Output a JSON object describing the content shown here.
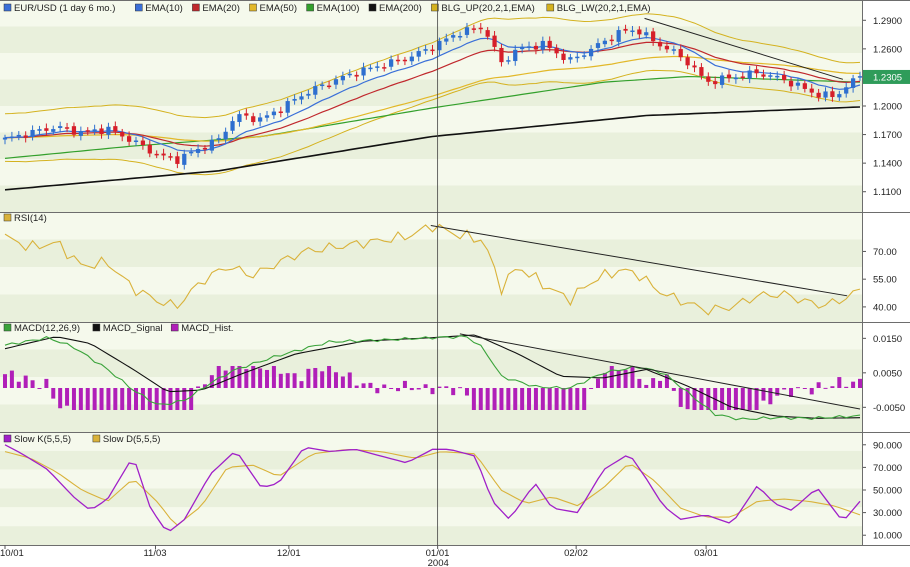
{
  "title": "EUR/USD (1 day 6 mo.)",
  "colors": {
    "background": "#ffffff",
    "band_light": "#f5f9ec",
    "band_dark": "#e9f0dc",
    "axis_text": "#222222",
    "up_candle": "#2e6fcf",
    "down_candle": "#d61f2a",
    "ema10": "#3a6fd8",
    "ema20": "#c0282d",
    "ema50": "#e2b829",
    "ema100": "#33a02c",
    "ema200": "#111111",
    "bollinger": "#d4b21f",
    "rsi": "#d9b23a",
    "macd": "#3aa33a",
    "macd_signal": "#111111",
    "macd_hist": "#b01fb8",
    "slow_k": "#a020c8",
    "slow_d": "#d9b23a",
    "trend": "#222222",
    "price_tag": "#2f9c5a"
  },
  "legends": {
    "price": [
      {
        "label": "EUR/USD (1 day 6 mo.)",
        "color": "#3a6fd8"
      },
      {
        "label": "EMA(10)",
        "color": "#3a6fd8"
      },
      {
        "label": "EMA(20)",
        "color": "#c0282d"
      },
      {
        "label": "EMA(50)",
        "color": "#e2b829"
      },
      {
        "label": "EMA(100)",
        "color": "#33a02c"
      },
      {
        "label": "EMA(200)",
        "color": "#111111"
      },
      {
        "label": "BLG_UP(20,2,1,EMA)",
        "color": "#d4b21f"
      },
      {
        "label": "BLG_LW(20,2,1,EMA)",
        "color": "#d4b21f"
      }
    ],
    "rsi": [
      {
        "label": "RSI(14)",
        "color": "#d9b23a"
      }
    ],
    "macd": [
      {
        "label": "MACD(12,26,9)",
        "color": "#3aa33a"
      },
      {
        "label": "MACD_Signal",
        "color": "#111111"
      },
      {
        "label": "MACD_Hist.",
        "color": "#b01fb8"
      }
    ],
    "stoch": [
      {
        "label": "Slow K(5,5,5)",
        "color": "#a020c8"
      },
      {
        "label": "Slow D(5,5,5)",
        "color": "#d9b23a"
      }
    ]
  },
  "current_price": "1.2305",
  "x_axis": {
    "labels": [
      {
        "text": "10/01",
        "t": 0
      },
      {
        "text": "11/03",
        "t": 0.176
      },
      {
        "text": "12/01",
        "t": 0.332
      },
      {
        "text": "01/01",
        "t": 0.506
      },
      {
        "text": "02/02",
        "t": 0.668
      },
      {
        "text": "03/01",
        "t": 0.82
      }
    ],
    "year_label": {
      "text": "2004",
      "t": 0.506
    }
  },
  "crosshair_t": 0.506,
  "chart_data": [
    {
      "type": "candlestick",
      "name": "EUR/USD (1 day 6 mo.)",
      "ylim": [
        1.095,
        1.305
      ],
      "yticks": [
        "1.2900",
        "1.2600",
        "1.2300",
        "1.2000",
        "1.1700",
        "1.1400",
        "1.1100"
      ],
      "close_anchors": [
        [
          0,
          1.165
        ],
        [
          0.03,
          1.172
        ],
        [
          0.06,
          1.178
        ],
        [
          0.09,
          1.172
        ],
        [
          0.12,
          1.176
        ],
        [
          0.15,
          1.163
        ],
        [
          0.18,
          1.148
        ],
        [
          0.2,
          1.143
        ],
        [
          0.22,
          1.152
        ],
        [
          0.25,
          1.165
        ],
        [
          0.27,
          1.19
        ],
        [
          0.3,
          1.186
        ],
        [
          0.32,
          1.196
        ],
        [
          0.35,
          1.213
        ],
        [
          0.38,
          1.225
        ],
        [
          0.41,
          1.235
        ],
        [
          0.44,
          1.243
        ],
        [
          0.47,
          1.25
        ],
        [
          0.5,
          1.262
        ],
        [
          0.53,
          1.277
        ],
        [
          0.56,
          1.283
        ],
        [
          0.58,
          1.245
        ],
        [
          0.6,
          1.26
        ],
        [
          0.63,
          1.265
        ],
        [
          0.66,
          1.247
        ],
        [
          0.69,
          1.262
        ],
        [
          0.72,
          1.278
        ],
        [
          0.74,
          1.28
        ],
        [
          0.76,
          1.267
        ],
        [
          0.78,
          1.258
        ],
        [
          0.8,
          1.245
        ],
        [
          0.82,
          1.225
        ],
        [
          0.85,
          1.23
        ],
        [
          0.88,
          1.235
        ],
        [
          0.91,
          1.228
        ],
        [
          0.93,
          1.22
        ],
        [
          0.95,
          1.212
        ],
        [
          0.97,
          1.21
        ],
        [
          1.0,
          1.232
        ]
      ],
      "ema200_anchors": [
        [
          0,
          1.112
        ],
        [
          0.25,
          1.132
        ],
        [
          0.5,
          1.168
        ],
        [
          0.75,
          1.19
        ],
        [
          1.0,
          1.199
        ]
      ],
      "ema100_anchors": [
        [
          0,
          1.145
        ],
        [
          0.15,
          1.158
        ],
        [
          0.3,
          1.168
        ],
        [
          0.5,
          1.198
        ],
        [
          0.7,
          1.225
        ],
        [
          0.8,
          1.231
        ],
        [
          1.0,
          1.225
        ]
      ],
      "band_anchors": [
        [
          0,
          0.025
        ],
        [
          0.18,
          0.03
        ],
        [
          0.3,
          0.03
        ],
        [
          0.5,
          0.03
        ],
        [
          0.6,
          0.035
        ],
        [
          0.75,
          0.03
        ],
        [
          0.85,
          0.025
        ],
        [
          1.0,
          0.02
        ]
      ],
      "trendline": {
        "t1": 0.748,
        "v1": 1.292,
        "t2": 0.98,
        "v2": 1.228
      }
    },
    {
      "type": "line",
      "name": "RSI(14)",
      "ylim": [
        34,
        87
      ],
      "yticks": [
        "70.00",
        "55.00",
        "40.00"
      ],
      "anchors": [
        [
          0,
          78
        ],
        [
          0.03,
          72
        ],
        [
          0.06,
          75
        ],
        [
          0.09,
          62
        ],
        [
          0.12,
          64
        ],
        [
          0.15,
          50
        ],
        [
          0.18,
          43
        ],
        [
          0.2,
          40
        ],
        [
          0.23,
          54
        ],
        [
          0.26,
          62
        ],
        [
          0.29,
          57
        ],
        [
          0.32,
          64
        ],
        [
          0.35,
          70
        ],
        [
          0.38,
          72
        ],
        [
          0.41,
          74
        ],
        [
          0.44,
          76
        ],
        [
          0.47,
          78
        ],
        [
          0.5,
          84
        ],
        [
          0.53,
          79
        ],
        [
          0.56,
          76
        ],
        [
          0.58,
          50
        ],
        [
          0.6,
          62
        ],
        [
          0.63,
          52
        ],
        [
          0.66,
          44
        ],
        [
          0.69,
          55
        ],
        [
          0.72,
          60
        ],
        [
          0.74,
          58
        ],
        [
          0.76,
          50
        ],
        [
          0.78,
          45
        ],
        [
          0.8,
          42
        ],
        [
          0.82,
          38
        ],
        [
          0.85,
          40
        ],
        [
          0.88,
          46
        ],
        [
          0.91,
          47
        ],
        [
          0.93,
          44
        ],
        [
          0.95,
          41
        ],
        [
          0.97,
          42
        ],
        [
          1.0,
          49
        ]
      ],
      "trendline": {
        "t1": 0.498,
        "v1": 84,
        "t2": 0.985,
        "v2": 46
      }
    },
    {
      "type": "bar_line_combo",
      "name": "MACD(12,26,9)",
      "ylim": [
        -0.011,
        0.018
      ],
      "yticks": [
        "0.0150",
        "0.0050",
        "-0.0050"
      ],
      "macd_anchors": [
        [
          0,
          0.013
        ],
        [
          0.05,
          0.0152
        ],
        [
          0.08,
          0.0125
        ],
        [
          0.12,
          0.006
        ],
        [
          0.15,
          0.0
        ],
        [
          0.18,
          -0.0045
        ],
        [
          0.21,
          -0.003
        ],
        [
          0.24,
          0.002
        ],
        [
          0.27,
          0.006
        ],
        [
          0.32,
          0.01
        ],
        [
          0.38,
          0.014
        ],
        [
          0.44,
          0.0145
        ],
        [
          0.5,
          0.0152
        ],
        [
          0.54,
          0.0155
        ],
        [
          0.56,
          0.012
        ],
        [
          0.58,
          0.004
        ],
        [
          0.62,
          0.001
        ],
        [
          0.66,
          0.0005
        ],
        [
          0.7,
          0.005
        ],
        [
          0.74,
          0.0068
        ],
        [
          0.77,
          0.005
        ],
        [
          0.8,
          -0.001
        ],
        [
          0.83,
          -0.007
        ],
        [
          0.86,
          -0.0085
        ],
        [
          0.9,
          -0.008
        ],
        [
          0.94,
          -0.0082
        ],
        [
          1.0,
          -0.0075
        ]
      ],
      "signal_anchors": [
        [
          0,
          0.012
        ],
        [
          0.06,
          0.0155
        ],
        [
          0.1,
          0.0135
        ],
        [
          0.15,
          0.006
        ],
        [
          0.19,
          -0.0005
        ],
        [
          0.23,
          0.0
        ],
        [
          0.28,
          0.005
        ],
        [
          0.34,
          0.0105
        ],
        [
          0.42,
          0.0142
        ],
        [
          0.5,
          0.0152
        ],
        [
          0.55,
          0.016
        ],
        [
          0.6,
          0.0105
        ],
        [
          0.65,
          0.004
        ],
        [
          0.7,
          0.0035
        ],
        [
          0.75,
          0.006
        ],
        [
          0.8,
          0.001
        ],
        [
          0.85,
          -0.005
        ],
        [
          0.9,
          -0.0075
        ],
        [
          0.95,
          -0.0082
        ],
        [
          1.0,
          -0.008
        ]
      ],
      "trendline": {
        "t1": 0.532,
        "v1": 0.0163,
        "t2": 1.0,
        "v2": -0.0055
      }
    },
    {
      "type": "line",
      "name": "Slow K(5,5,5)",
      "ylim": [
        4,
        96
      ],
      "yticks": [
        "90.000",
        "70.000",
        "50.000",
        "30.000",
        "10.000"
      ],
      "k_anchors": [
        [
          0,
          90
        ],
        [
          0.02,
          82
        ],
        [
          0.05,
          68
        ],
        [
          0.08,
          44
        ],
        [
          0.1,
          32
        ],
        [
          0.12,
          42
        ],
        [
          0.15,
          80
        ],
        [
          0.17,
          34
        ],
        [
          0.19,
          12
        ],
        [
          0.21,
          24
        ],
        [
          0.24,
          64
        ],
        [
          0.27,
          85
        ],
        [
          0.3,
          52
        ],
        [
          0.32,
          56
        ],
        [
          0.35,
          88
        ],
        [
          0.38,
          84
        ],
        [
          0.41,
          86
        ],
        [
          0.44,
          80
        ],
        [
          0.47,
          74
        ],
        [
          0.5,
          86
        ],
        [
          0.52,
          86
        ],
        [
          0.55,
          80
        ],
        [
          0.57,
          40
        ],
        [
          0.59,
          24
        ],
        [
          0.62,
          56
        ],
        [
          0.64,
          34
        ],
        [
          0.67,
          30
        ],
        [
          0.7,
          68
        ],
        [
          0.73,
          82
        ],
        [
          0.75,
          60
        ],
        [
          0.77,
          36
        ],
        [
          0.79,
          24
        ],
        [
          0.82,
          28
        ],
        [
          0.85,
          20
        ],
        [
          0.88,
          54
        ],
        [
          0.9,
          38
        ],
        [
          0.92,
          32
        ],
        [
          0.95,
          52
        ],
        [
          0.98,
          22
        ],
        [
          1.0,
          40
        ]
      ],
      "d_anchors": [
        [
          0,
          84
        ],
        [
          0.03,
          78
        ],
        [
          0.06,
          66
        ],
        [
          0.09,
          50
        ],
        [
          0.12,
          40
        ],
        [
          0.15,
          60
        ],
        [
          0.18,
          38
        ],
        [
          0.2,
          18
        ],
        [
          0.23,
          36
        ],
        [
          0.26,
          70
        ],
        [
          0.29,
          72
        ],
        [
          0.32,
          62
        ],
        [
          0.36,
          82
        ],
        [
          0.4,
          86
        ],
        [
          0.44,
          84
        ],
        [
          0.48,
          78
        ],
        [
          0.51,
          84
        ],
        [
          0.55,
          82
        ],
        [
          0.58,
          50
        ],
        [
          0.61,
          38
        ],
        [
          0.64,
          44
        ],
        [
          0.67,
          36
        ],
        [
          0.7,
          52
        ],
        [
          0.73,
          74
        ],
        [
          0.76,
          58
        ],
        [
          0.79,
          34
        ],
        [
          0.82,
          26
        ],
        [
          0.85,
          26
        ],
        [
          0.88,
          40
        ],
        [
          0.91,
          42
        ],
        [
          0.94,
          40
        ],
        [
          0.97,
          36
        ],
        [
          1.0,
          28
        ]
      ]
    }
  ]
}
